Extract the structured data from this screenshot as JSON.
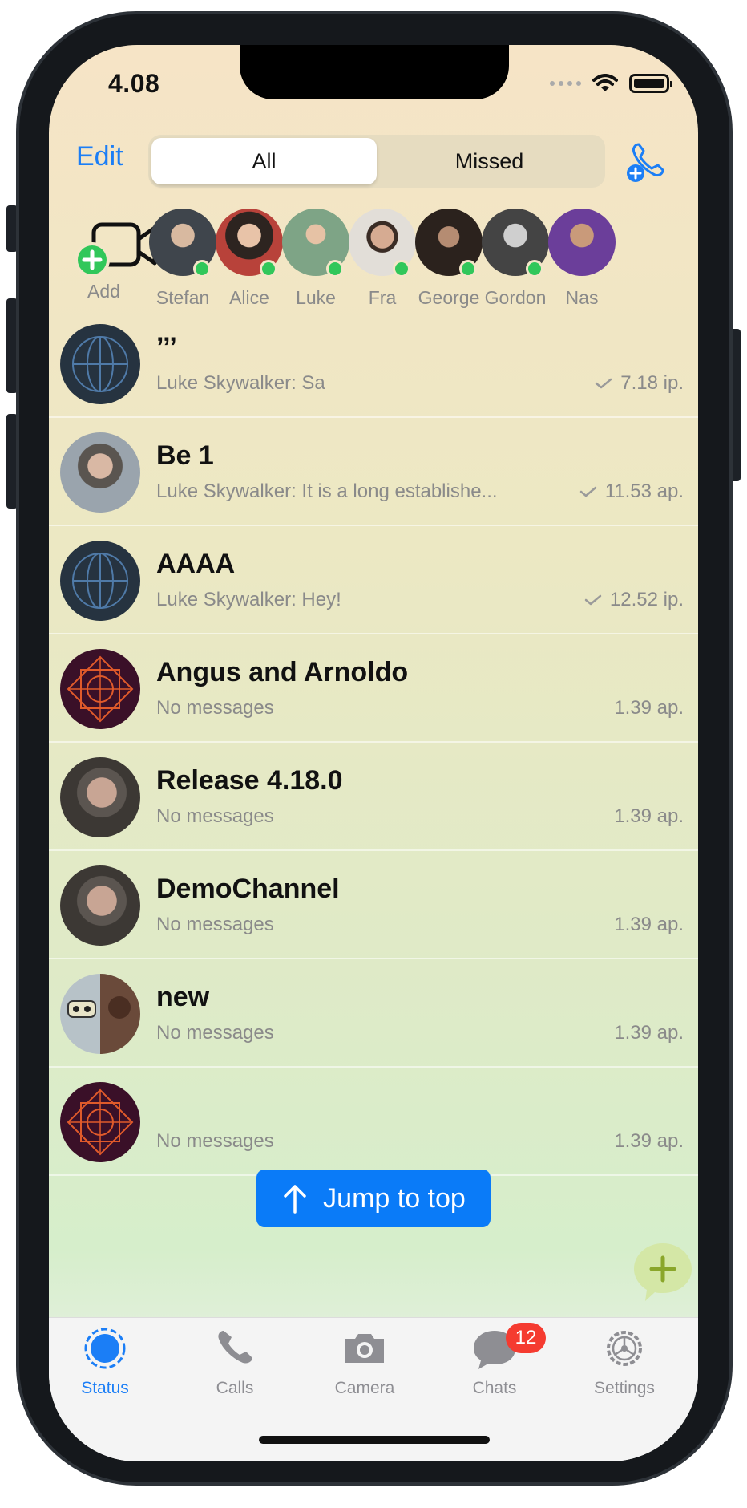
{
  "status_bar": {
    "time": "4.08"
  },
  "header": {
    "edit_label": "Edit",
    "segments": [
      {
        "label": "All",
        "active": true
      },
      {
        "label": "Missed",
        "active": false
      }
    ],
    "new_call_icon": "add-call-icon"
  },
  "stories": {
    "add_label": "Add",
    "items": [
      {
        "name": "Stefan",
        "online": true,
        "color": "#4a4f55"
      },
      {
        "name": "Alice",
        "online": true,
        "color": "#b84a3a"
      },
      {
        "name": "Luke",
        "online": true,
        "color": "#6ca88a"
      },
      {
        "name": "Fra",
        "online": true,
        "color": "#d9d3cc"
      },
      {
        "name": "George",
        "online": true,
        "color": "#3a2f28"
      },
      {
        "name": "Gordon",
        "online": true,
        "color": "#7b7b7b"
      },
      {
        "name": "Nas",
        "online": false,
        "color": "#8a5fa8"
      }
    ]
  },
  "chats": [
    {
      "title": "’’’",
      "preview": "Luke Skywalker: Sa",
      "time": "7.18 ip.",
      "read_check": true,
      "avatar": "dark-globe"
    },
    {
      "title": "Be 1",
      "preview": "Luke Skywalker: It is a long establishe...",
      "time": "11.53 ap.",
      "read_check": true,
      "avatar": "photo-leia"
    },
    {
      "title": "AAAA",
      "preview": "Luke Skywalker: Hey!",
      "time": "12.52 ip.",
      "read_check": true,
      "avatar": "dark-globe"
    },
    {
      "title": "Angus and Arnoldo",
      "preview": "No messages",
      "time": "1.39 ap.",
      "read_check": false,
      "avatar": "geometric-orange"
    },
    {
      "title": "Release 4.18.0",
      "preview": "No messages",
      "time": "1.39 ap.",
      "read_check": false,
      "avatar": "photo-han"
    },
    {
      "title": "DemoChannel",
      "preview": "No messages",
      "time": "1.39 ap.",
      "read_check": false,
      "avatar": "photo-han"
    },
    {
      "title": "new",
      "preview": "No messages",
      "time": "1.39 ap.",
      "read_check": false,
      "avatar": "split-bender-lando"
    },
    {
      "title": "",
      "preview": "No messages",
      "time": "1.39 ap.",
      "read_check": false,
      "avatar": "geometric-orange"
    }
  ],
  "jump_to_top": {
    "label": "Jump to top"
  },
  "tabbar": {
    "tabs": [
      {
        "label": "Status",
        "icon": "status-ring-icon",
        "active": true
      },
      {
        "label": "Calls",
        "icon": "phone-icon",
        "active": false
      },
      {
        "label": "Camera",
        "icon": "camera-icon",
        "active": false
      },
      {
        "label": "Chats",
        "icon": "chat-bubble-icon",
        "active": false,
        "badge": "12"
      },
      {
        "label": "Settings",
        "icon": "gear-icon",
        "active": false
      }
    ]
  },
  "colors": {
    "accent": "#1b7ef6",
    "online": "#31c75a",
    "badge": "#f53b30",
    "jump_button": "#0a7bf8"
  }
}
